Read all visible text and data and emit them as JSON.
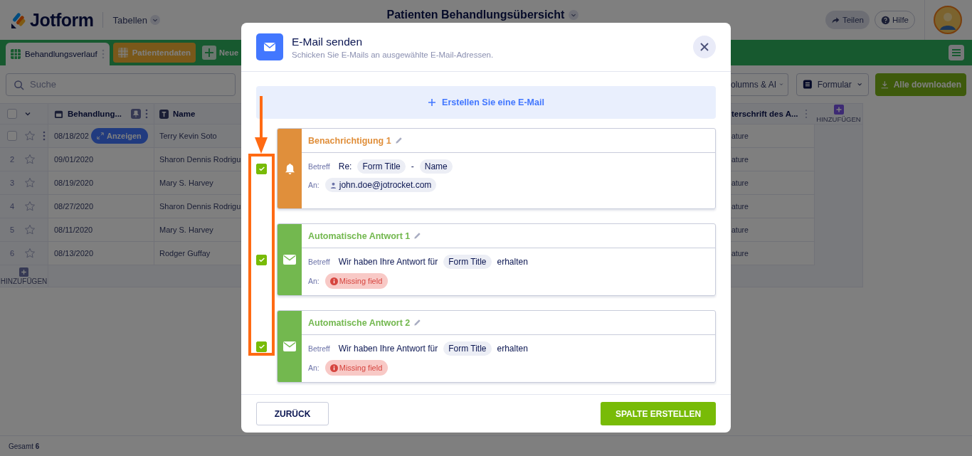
{
  "header": {
    "logo": "Jotform",
    "section": "Tabellen",
    "title": "Patienten Behandlungsübersicht",
    "share": "Teilen",
    "help": "Hilfe"
  },
  "tabs": [
    {
      "label": "Behandlungsverlauf",
      "kind": "table",
      "selected": true
    },
    {
      "label": "Patientendaten",
      "kind": "table",
      "selected": false
    },
    {
      "label": "Neue",
      "kind": "add",
      "selected": false
    }
  ],
  "toolbar": {
    "search_placeholder": "Suche",
    "columns_button": "olumns & AI",
    "form_button": "Formular",
    "download_button": "Alle downloaden"
  },
  "table": {
    "select_all_checked": false,
    "columns": [
      {
        "label": "Behandlung...",
        "kind": "date"
      },
      {
        "label": "Name",
        "kind": "text"
      }
    ],
    "rows": [
      {
        "hovered": true,
        "checked": false,
        "action": "Anzeigen",
        "date": "08/18/202",
        "name": "Terry Kevin Soto"
      },
      {
        "number": "2",
        "hovered": false,
        "date": "09/01/2020",
        "name": "Sharon Dennis Rodrigu"
      },
      {
        "number": "3",
        "hovered": false,
        "date": "08/19/2020",
        "name": "Mary S. Harvey"
      },
      {
        "number": "4",
        "hovered": false,
        "date": "08/27/2020",
        "name": "Sharon Dennis Rodrigu"
      },
      {
        "number": "5",
        "hovered": false,
        "date": "08/11/2020",
        "name": "Mary S. Harvey"
      },
      {
        "number": "6",
        "hovered": false,
        "date": "08/13/2020",
        "name": "Rodger Guffay"
      }
    ],
    "cut_column": {
      "label": "terschrift des A...",
      "cells": [
        "ature",
        "ature",
        "ature",
        "ature",
        "ature",
        "ature"
      ]
    },
    "add_column": "HINZUFÜGEN",
    "add_row": "HINZUFÜGEN"
  },
  "status_bar": "Gesamt **6**",
  "dialog": {
    "title": "E-Mail senden",
    "subtitle": "Schicken Sie E-Mails an ausgewählte E-Mail-Adressen.",
    "create": "Erstellen Sie eine E-Mail",
    "emails": [
      {
        "kind": "notification",
        "title": "Benachrichtigung 1",
        "checked": true,
        "subject_label": "Betreff",
        "subject": [
          {
            "kind": "text",
            "text": "Re:"
          },
          {
            "kind": "chip",
            "text": "Form Title"
          },
          {
            "kind": "text",
            "text": "-"
          },
          {
            "kind": "chip",
            "text": "Name"
          }
        ],
        "to_label": "An:",
        "to": {
          "kind": "email",
          "text": "john.doe@jotrocket.com"
        }
      },
      {
        "kind": "autoresponder",
        "title": "Automatische Antwort 1",
        "checked": true,
        "subject_label": "Betreff",
        "subject": [
          {
            "kind": "text",
            "text": "Wir haben Ihre Antwort für"
          },
          {
            "kind": "chip",
            "text": "Form Title"
          },
          {
            "kind": "text",
            "text": "erhalten"
          }
        ],
        "to_label": "An:",
        "to": {
          "kind": "missing",
          "text": "Missing field"
        }
      },
      {
        "kind": "autoresponder",
        "title": "Automatische Antwort 2",
        "checked": true,
        "subject_label": "Betreff",
        "subject": [
          {
            "kind": "text",
            "text": "Wir haben Ihre Antwort für"
          },
          {
            "kind": "chip",
            "text": "Form Title"
          },
          {
            "kind": "text",
            "text": "erhalten"
          }
        ],
        "to_label": "An:",
        "to": {
          "kind": "missing",
          "text": "Missing field"
        }
      }
    ],
    "back": "ZURÜCK",
    "submit": "SPALTE ERSTELLEN"
  }
}
